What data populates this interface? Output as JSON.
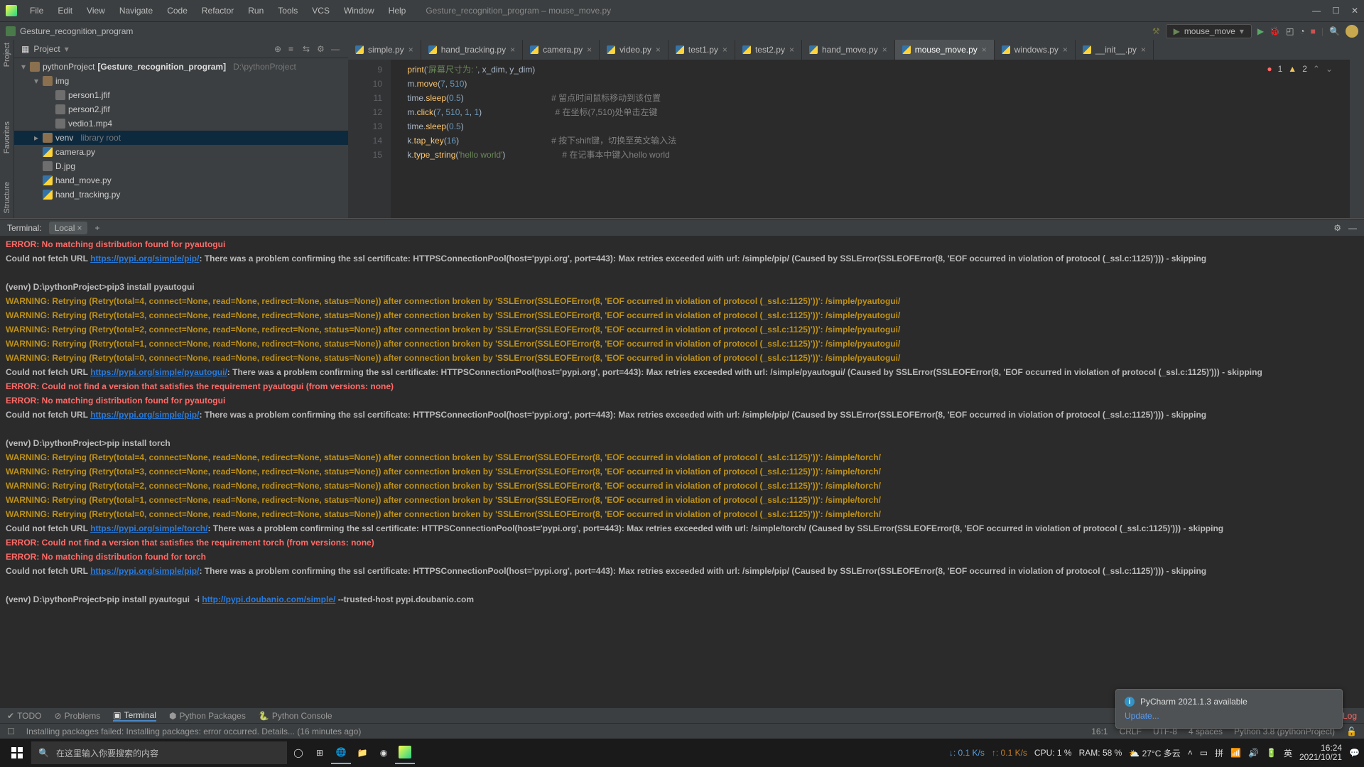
{
  "menubar": [
    "File",
    "Edit",
    "View",
    "Navigate",
    "Code",
    "Refactor",
    "Run",
    "Tools",
    "VCS",
    "Window",
    "Help"
  ],
  "window_title": "Gesture_recognition_program – mouse_move.py",
  "breadcrumb": "Gesture_recognition_program",
  "run_config": "mouse_move",
  "toolbar_icons": [
    "hammer",
    "run-green",
    "debug",
    "coverage",
    "profile",
    "stop",
    "search",
    "avatar"
  ],
  "project": {
    "title": "Project",
    "tree": [
      {
        "depth": 0,
        "caret": "▾",
        "icon": "folder",
        "label": "pythonProject",
        "bold": "[Gesture_recognition_program]",
        "dim": "D:\\pythonProject"
      },
      {
        "depth": 1,
        "caret": "▾",
        "icon": "folder",
        "label": "img"
      },
      {
        "depth": 2,
        "caret": "",
        "icon": "file",
        "label": "person1.jfif"
      },
      {
        "depth": 2,
        "caret": "",
        "icon": "file",
        "label": "person2.jfif"
      },
      {
        "depth": 2,
        "caret": "",
        "icon": "file",
        "label": "vedio1.mp4"
      },
      {
        "depth": 1,
        "caret": "▸",
        "icon": "folder",
        "label": "venv",
        "dim": "library root",
        "sel": true
      },
      {
        "depth": 1,
        "caret": "",
        "icon": "py",
        "label": "camera.py"
      },
      {
        "depth": 1,
        "caret": "",
        "icon": "file",
        "label": "D.jpg"
      },
      {
        "depth": 1,
        "caret": "",
        "icon": "py",
        "label": "hand_move.py"
      },
      {
        "depth": 1,
        "caret": "",
        "icon": "py",
        "label": "hand_tracking.py"
      }
    ]
  },
  "tabs": [
    {
      "label": "simple.py"
    },
    {
      "label": "hand_tracking.py"
    },
    {
      "label": "camera.py"
    },
    {
      "label": "video.py"
    },
    {
      "label": "test1.py"
    },
    {
      "label": "test2.py"
    },
    {
      "label": "hand_move.py"
    },
    {
      "label": "mouse_move.py",
      "active": true
    },
    {
      "label": "windows.py"
    },
    {
      "label": "__init__.py"
    }
  ],
  "inspections": {
    "errors": "1",
    "warnings": "2"
  },
  "code": {
    "start": 9,
    "lines": [
      {
        "n": 9,
        "t": "    print('屏幕尺寸为: ', x_dim, y_dim)"
      },
      {
        "n": 10,
        "t": "    m.move(7, 510)"
      },
      {
        "n": 11,
        "t": "    time.sleep(0.5)",
        "c": "# 留点时间鼠标移动到该位置"
      },
      {
        "n": 12,
        "t": "    m.click(7, 510, 1, 1)",
        "c": "# 在坐标(7,510)处单击左键"
      },
      {
        "n": 13,
        "t": "    time.sleep(0.5)"
      },
      {
        "n": 14,
        "t": "    k.tap_key(16)",
        "c": "# 按下shift键，切换至英文输入法"
      },
      {
        "n": 15,
        "t": "    k.type_string('hello world')",
        "c": "# 在记事本中键入hello world"
      }
    ]
  },
  "terminal": {
    "title": "Terminal:",
    "tab": "Local",
    "lines": [
      {
        "cls": "err",
        "t": "ERROR: No matching distribution found for pyautogui"
      },
      {
        "cls": "norm",
        "t": "Could not fetch URL https://pypi.org/simple/pip/: There was a problem confirming the ssl certificate: HTTPSConnectionPool(host='pypi.org', port=443): Max retries exceeded with url: /simple/pip/ (Caused by SSLError(SSLEOFError(8, 'EOF occurred in violation of protocol (_ssl.c:1125)'))) - skipping"
      },
      {
        "cls": "norm",
        "t": " "
      },
      {
        "cls": "norm",
        "t": "(venv) D:\\pythonProject>pip3 install pyautogui"
      },
      {
        "cls": "warnl",
        "t": "WARNING: Retrying (Retry(total=4, connect=None, read=None, redirect=None, status=None)) after connection broken by 'SSLError(SSLEOFError(8, 'EOF occurred in violation of protocol (_ssl.c:1125)'))': /simple/pyautogui/"
      },
      {
        "cls": "warnl",
        "t": "WARNING: Retrying (Retry(total=3, connect=None, read=None, redirect=None, status=None)) after connection broken by 'SSLError(SSLEOFError(8, 'EOF occurred in violation of protocol (_ssl.c:1125)'))': /simple/pyautogui/"
      },
      {
        "cls": "warnl",
        "t": "WARNING: Retrying (Retry(total=2, connect=None, read=None, redirect=None, status=None)) after connection broken by 'SSLError(SSLEOFError(8, 'EOF occurred in violation of protocol (_ssl.c:1125)'))': /simple/pyautogui/"
      },
      {
        "cls": "warnl",
        "t": "WARNING: Retrying (Retry(total=1, connect=None, read=None, redirect=None, status=None)) after connection broken by 'SSLError(SSLEOFError(8, 'EOF occurred in violation of protocol (_ssl.c:1125)'))': /simple/pyautogui/"
      },
      {
        "cls": "warnl",
        "t": "WARNING: Retrying (Retry(total=0, connect=None, read=None, redirect=None, status=None)) after connection broken by 'SSLError(SSLEOFError(8, 'EOF occurred in violation of protocol (_ssl.c:1125)'))': /simple/pyautogui/"
      },
      {
        "cls": "norm",
        "t": "Could not fetch URL https://pypi.org/simple/pyautogui/: There was a problem confirming the ssl certificate: HTTPSConnectionPool(host='pypi.org', port=443): Max retries exceeded with url: /simple/pyautogui/ (Caused by SSLError(SSLEOFError(8, 'EOF occurred in violation of protocol (_ssl.c:1125)'))) - skipping"
      },
      {
        "cls": "err",
        "t": "ERROR: Could not find a version that satisfies the requirement pyautogui (from versions: none)"
      },
      {
        "cls": "err",
        "t": "ERROR: No matching distribution found for pyautogui"
      },
      {
        "cls": "norm",
        "t": "Could not fetch URL https://pypi.org/simple/pip/: There was a problem confirming the ssl certificate: HTTPSConnectionPool(host='pypi.org', port=443): Max retries exceeded with url: /simple/pip/ (Caused by SSLError(SSLEOFError(8, 'EOF occurred in violation of protocol (_ssl.c:1125)'))) - skipping"
      },
      {
        "cls": "norm",
        "t": " "
      },
      {
        "cls": "norm",
        "t": "(venv) D:\\pythonProject>pip install torch"
      },
      {
        "cls": "warnl",
        "t": "WARNING: Retrying (Retry(total=4, connect=None, read=None, redirect=None, status=None)) after connection broken by 'SSLError(SSLEOFError(8, 'EOF occurred in violation of protocol (_ssl.c:1125)'))': /simple/torch/"
      },
      {
        "cls": "warnl",
        "t": "WARNING: Retrying (Retry(total=3, connect=None, read=None, redirect=None, status=None)) after connection broken by 'SSLError(SSLEOFError(8, 'EOF occurred in violation of protocol (_ssl.c:1125)'))': /simple/torch/"
      },
      {
        "cls": "warnl",
        "t": "WARNING: Retrying (Retry(total=2, connect=None, read=None, redirect=None, status=None)) after connection broken by 'SSLError(SSLEOFError(8, 'EOF occurred in violation of protocol (_ssl.c:1125)'))': /simple/torch/"
      },
      {
        "cls": "warnl",
        "t": "WARNING: Retrying (Retry(total=1, connect=None, read=None, redirect=None, status=None)) after connection broken by 'SSLError(SSLEOFError(8, 'EOF occurred in violation of protocol (_ssl.c:1125)'))': /simple/torch/"
      },
      {
        "cls": "warnl",
        "t": "WARNING: Retrying (Retry(total=0, connect=None, read=None, redirect=None, status=None)) after connection broken by 'SSLError(SSLEOFError(8, 'EOF occurred in violation of protocol (_ssl.c:1125)'))': /simple/torch/"
      },
      {
        "cls": "norm",
        "t": "Could not fetch URL https://pypi.org/simple/torch/: There was a problem confirming the ssl certificate: HTTPSConnectionPool(host='pypi.org', port=443): Max retries exceeded with url: /simple/torch/ (Caused by SSLError(SSLEOFError(8, 'EOF occurred in violation of protocol (_ssl.c:1125)'))) - skipping"
      },
      {
        "cls": "err",
        "t": "ERROR: Could not find a version that satisfies the requirement torch (from versions: none)"
      },
      {
        "cls": "err",
        "t": "ERROR: No matching distribution found for torch"
      },
      {
        "cls": "norm",
        "t": "Could not fetch URL https://pypi.org/simple/pip/: There was a problem confirming the ssl certificate: HTTPSConnectionPool(host='pypi.org', port=443): Max retries exceeded with url: /simple/pip/ (Caused by SSLError(SSLEOFError(8, 'EOF occurred in violation of protocol (_ssl.c:1125)'))) - skipping"
      },
      {
        "cls": "norm",
        "t": " "
      },
      {
        "cls": "norm",
        "t": "(venv) D:\\pythonProject>pip install pyautogui  -i http://pypi.doubanio.com/simple/ --trusted-host pypi.doubanio.com"
      }
    ]
  },
  "bottom_toolwindows": [
    "TODO",
    "Problems",
    "Terminal",
    "Python Packages",
    "Python Console"
  ],
  "bottom_active": 2,
  "event_log": "Event Log",
  "status_msg": "Installing packages failed: Installing packages: error occurred. Details... (16 minutes ago)",
  "status_right": {
    "pos": "16:1",
    "sep": "CRLF",
    "enc": "UTF-8",
    "indent": "4 spaces",
    "interp": "Python 3.8 (pythonProject)"
  },
  "notif": {
    "title": "PyCharm 2021.1.3 available",
    "link": "Update..."
  },
  "left_toolwindows": [
    "Project",
    "Favorites",
    "Structure"
  ],
  "taskbar": {
    "search_placeholder": "在这里输入你要搜索的内容",
    "net": {
      "down": "↓: 0.1 K/s",
      "up": "↑: 0.1 K/s"
    },
    "cpu": "CPU: 1 %",
    "ram": "RAM:   58 %",
    "weather": "27°C 多云",
    "time": "16:24",
    "date": "2021/10/21"
  }
}
